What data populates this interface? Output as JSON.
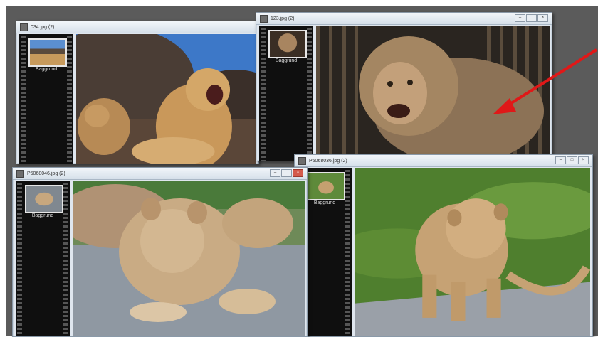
{
  "windows": [
    {
      "title": "034.jpg (2)",
      "layer_label": "Baggrund"
    },
    {
      "title": "123.jpg (2)",
      "layer_label": "Baggrund"
    },
    {
      "title": "P5068046.jpg (2)",
      "layer_label": "Baggrund"
    },
    {
      "title": "P5068036.jpg (2)",
      "layer_label": "Baggrund"
    }
  ],
  "icons": [
    "app-icon",
    "minimize-icon",
    "maximize-icon",
    "close-icon"
  ],
  "colors": {
    "desktop_bg": "#5b5b5b",
    "titlebar": "#dfe6ee",
    "layer_panel": "#0f0f0f",
    "pointer_arrow": "#e01818"
  }
}
